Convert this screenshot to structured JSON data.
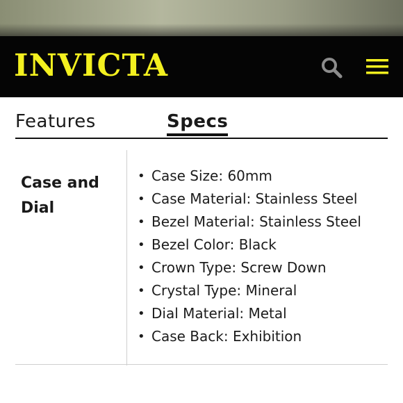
{
  "brand": {
    "logo_text": "INVICTA",
    "logo_color": "#f3f01f",
    "header_bg": "#050505"
  },
  "header": {
    "search_icon": "search-icon",
    "menu_icon": "hamburger-menu-icon"
  },
  "tabs": [
    {
      "label": "Features",
      "active": false
    },
    {
      "label": "Specs",
      "active": true
    }
  ],
  "specs": {
    "section_label": "Case and Dial",
    "items": [
      "Case Size: 60mm",
      "Case Material: Stainless Steel",
      "Bezel Material: Stainless Steel",
      "Bezel Color: Black",
      "Crown Type: Screw Down",
      "Crystal Type: Mineral",
      "Dial Material: Metal",
      "Case Back: Exhibition"
    ]
  }
}
